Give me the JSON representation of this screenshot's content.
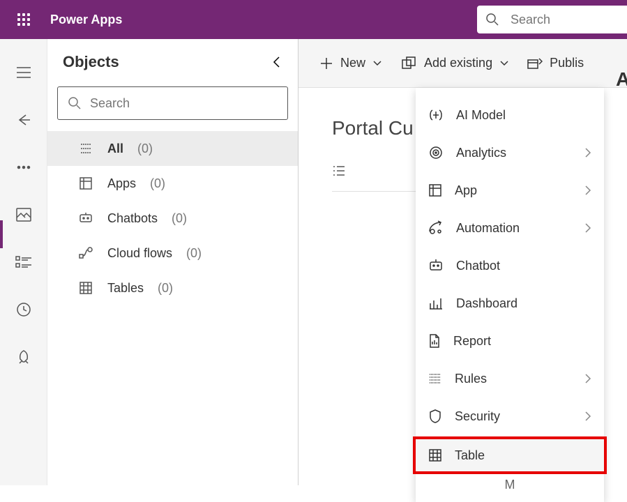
{
  "header": {
    "app_name": "Power Apps",
    "search_placeholder": "Search"
  },
  "objects_panel": {
    "title": "Objects",
    "search_placeholder": "Search",
    "items": [
      {
        "label": "All",
        "count": "(0)",
        "icon": "all-icon",
        "active": true
      },
      {
        "label": "Apps",
        "count": "(0)",
        "icon": "app-icon",
        "active": false
      },
      {
        "label": "Chatbots",
        "count": "(0)",
        "icon": "chatbot-icon",
        "active": false
      },
      {
        "label": "Cloud flows",
        "count": "(0)",
        "icon": "flow-icon",
        "active": false
      },
      {
        "label": "Tables",
        "count": "(0)",
        "icon": "table-icon",
        "active": false
      }
    ]
  },
  "cmdbar": {
    "new_label": "New",
    "addexisting_label": "Add existing",
    "publish_label": "Publis"
  },
  "main": {
    "page_title": "Portal Cu",
    "rightedge_letter": "A"
  },
  "dropdown": {
    "items": [
      {
        "label": "AI Model",
        "icon": "ai-icon",
        "arrow": false
      },
      {
        "label": "Analytics",
        "icon": "analytics-icon",
        "arrow": true
      },
      {
        "label": "App",
        "icon": "app-icon",
        "arrow": true
      },
      {
        "label": "Automation",
        "icon": "automation-icon",
        "arrow": true
      },
      {
        "label": "Chatbot",
        "icon": "chatbot-icon",
        "arrow": false
      },
      {
        "label": "Dashboard",
        "icon": "dashboard-icon",
        "arrow": false
      },
      {
        "label": "Report",
        "icon": "report-icon",
        "arrow": false
      },
      {
        "label": "Rules",
        "icon": "rules-icon",
        "arrow": true
      },
      {
        "label": "Security",
        "icon": "security-icon",
        "arrow": true
      },
      {
        "label": "Table",
        "icon": "table-icon",
        "arrow": false,
        "highlight": true
      }
    ],
    "more_label": "M"
  },
  "iconrail": {
    "items": [
      {
        "icon": "hamburger-icon"
      },
      {
        "icon": "back-icon"
      },
      {
        "icon": "more-icon"
      },
      {
        "icon": "image-icon"
      },
      {
        "icon": "list-icon",
        "selected": true
      },
      {
        "icon": "history-icon"
      },
      {
        "icon": "rocket-icon"
      }
    ]
  }
}
